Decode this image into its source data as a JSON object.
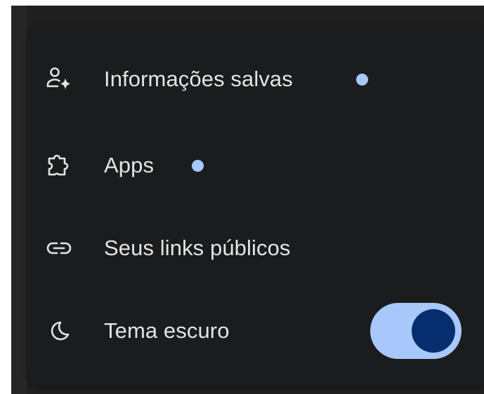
{
  "menu": {
    "items": [
      {
        "label": "Informações salvas",
        "icon": "person-sparkle-icon",
        "has_indicator": true
      },
      {
        "label": "Apps",
        "icon": "puzzle-icon",
        "has_indicator": true
      },
      {
        "label": "Seus links públicos",
        "icon": "link-icon",
        "has_indicator": false
      },
      {
        "label": "Tema escuro",
        "icon": "moon-icon",
        "has_indicator": false
      }
    ]
  },
  "dark_theme_toggle": {
    "state": "on"
  },
  "colors": {
    "menu_background": "#1b1c1d",
    "text": "#e3e3e3",
    "indicator_dot": "#a8c7fa",
    "toggle_track": "#a8c7fa",
    "toggle_knob": "#062e6f"
  }
}
